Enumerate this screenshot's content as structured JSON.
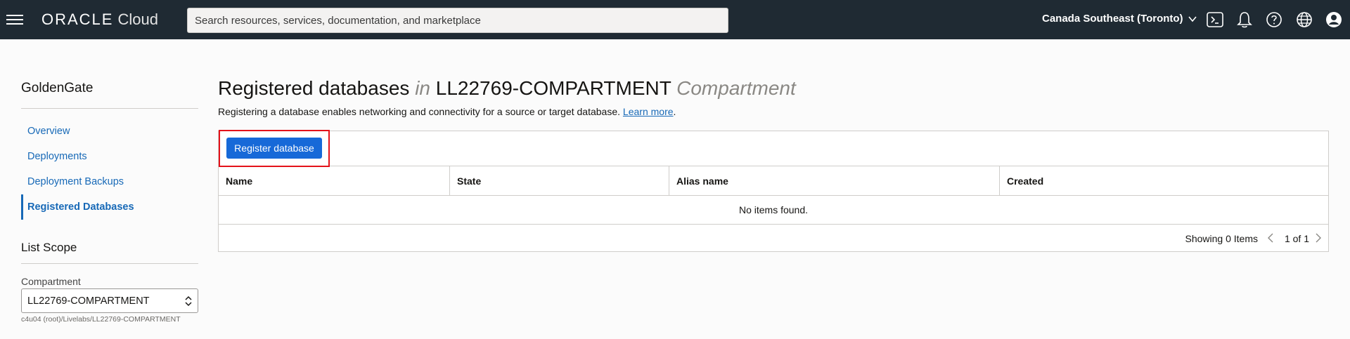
{
  "header": {
    "brand_oracle": "ORACLE",
    "brand_cloud": "Cloud",
    "search_placeholder": "Search resources, services, documentation, and marketplace",
    "region": "Canada Southeast (Toronto)",
    "icons": [
      "menu-icon",
      "cloud-shell-icon",
      "bell-icon",
      "help-icon",
      "globe-icon",
      "user-icon"
    ]
  },
  "sidebar": {
    "title": "GoldenGate",
    "items": [
      {
        "label": "Overview",
        "active": false
      },
      {
        "label": "Deployments",
        "active": false
      },
      {
        "label": "Deployment Backups",
        "active": false
      },
      {
        "label": "Registered Databases",
        "active": true
      }
    ],
    "scope_title": "List Scope",
    "compartment_label": "Compartment",
    "compartment_value": "LL22769-COMPARTMENT",
    "compartment_path": "c4u04 (root)/Livelabs/LL22769-COMPARTMENT"
  },
  "main": {
    "title_prefix": "Registered databases",
    "title_in": "in",
    "title_compartment": "LL22769-COMPARTMENT",
    "title_suffix": "Compartment",
    "description": "Registering a database enables networking and connectivity for a source or target database.",
    "learn_more": "Learn more",
    "register_button": "Register database",
    "columns": [
      "Name",
      "State",
      "Alias name",
      "Created"
    ],
    "empty_message": "No items found.",
    "showing": "Showing 0 Items",
    "pagination": "1 of 1"
  },
  "colors": {
    "header_bg": "#1f2a33",
    "link": "#1769b7",
    "primary_button": "#1769d8",
    "highlight": "#e4121a"
  }
}
